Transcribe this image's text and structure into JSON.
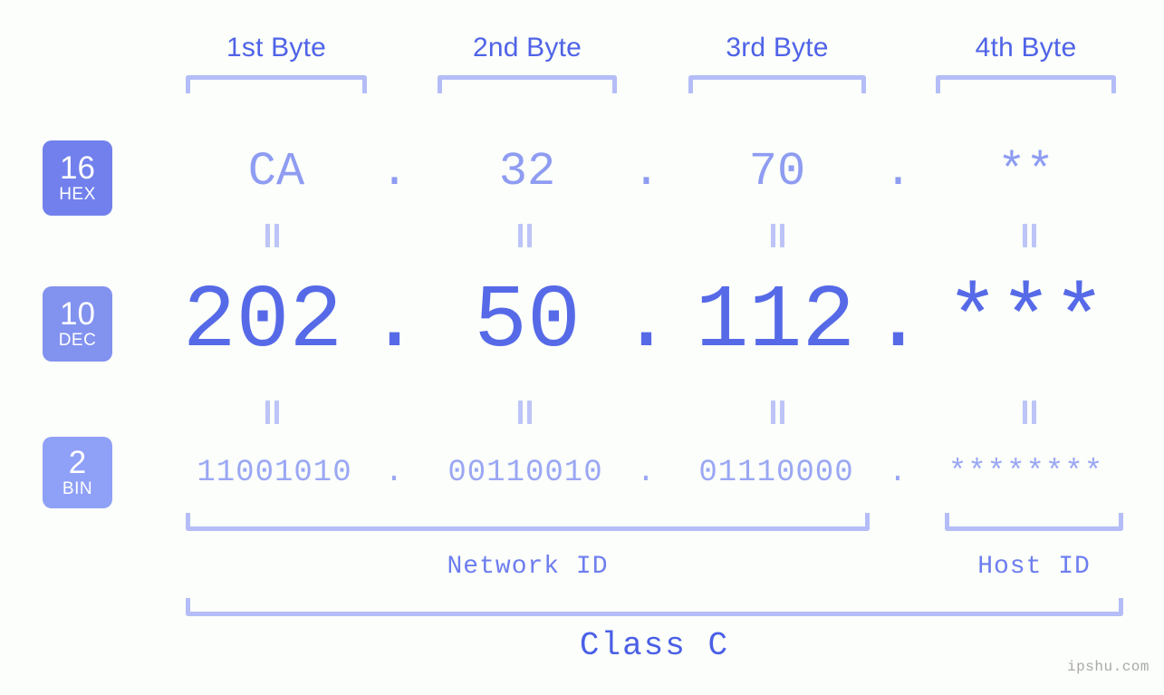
{
  "meta": {
    "watermark": "ipshu.com",
    "accent_strong": "#4f63e8",
    "accent_mid": "#8e9cf2",
    "accent_light": "#b4bdf7",
    "background": "#fbfefa"
  },
  "headers": [
    {
      "label": "1st Byte"
    },
    {
      "label": "2nd Byte"
    },
    {
      "label": "3rd Byte"
    },
    {
      "label": "4th Byte"
    }
  ],
  "bases": [
    {
      "number": "16",
      "name": "HEX",
      "color": "#7180ec"
    },
    {
      "number": "10",
      "name": "DEC",
      "color": "#8292ef"
    },
    {
      "number": "2",
      "name": "BIN",
      "color": "#8fa0f7"
    }
  ],
  "rows": {
    "hex": {
      "values": [
        "CA",
        "32",
        "70",
        "**"
      ],
      "separator": "."
    },
    "dec": {
      "values": [
        "202",
        "50",
        "112",
        "***"
      ],
      "separator": "."
    },
    "bin": {
      "values": [
        "11001010",
        "00110010",
        "01110000",
        "********"
      ],
      "separator": "."
    }
  },
  "equals_marks": {
    "symbol": "||",
    "count_per_row": 4
  },
  "segments": [
    {
      "label": "Network ID"
    },
    {
      "label": "Host ID"
    }
  ],
  "class": {
    "label": "Class C"
  }
}
